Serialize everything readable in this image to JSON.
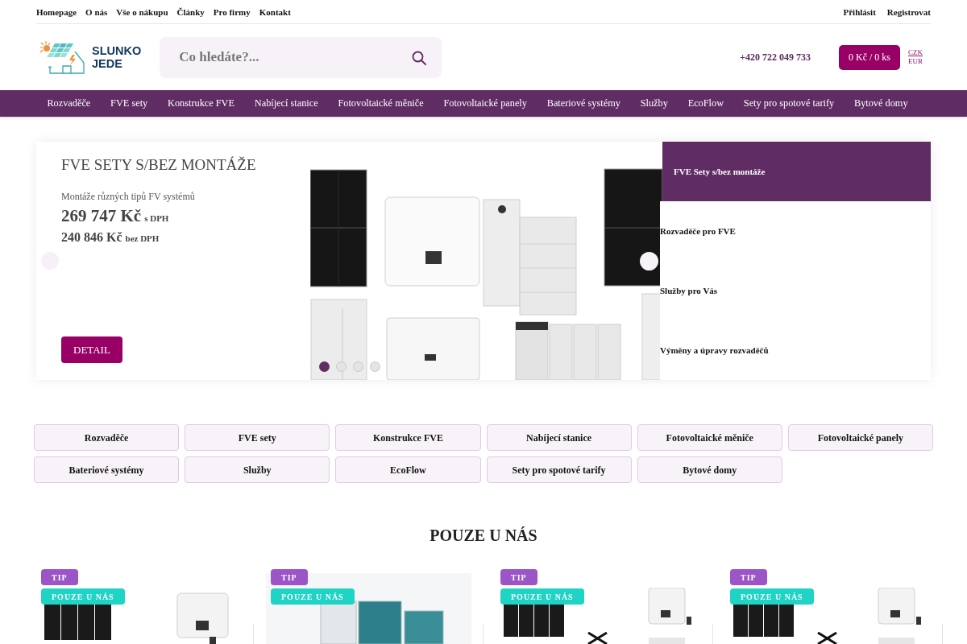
{
  "top_links": [
    "Homepage",
    "O nás",
    "Vše o nákupu",
    "Články",
    "Pro firmy",
    "Kontakt"
  ],
  "account_links": [
    "Přihlásit",
    "Registrovat"
  ],
  "logo": {
    "text_lines": [
      "SLUNKO",
      "JEDE"
    ]
  },
  "search": {
    "placeholder": "Co hledáte?..."
  },
  "phone": "+420 722 049 733",
  "cart": {
    "label": "0 Kč / 0 ks"
  },
  "currencies": [
    {
      "label": "CZK",
      "selected": true
    },
    {
      "label": "EUR",
      "selected": false
    }
  ],
  "nav": [
    "Rozvaděče",
    "FVE sety",
    "Konstrukce FVE",
    "Nabíjecí stanice",
    "Fotovoltaické měniče",
    "Fotovoltaické panely",
    "Bateriové systémy",
    "Služby",
    "EcoFlow",
    "Sety pro spotové tarify",
    "Bytové domy"
  ],
  "hero": {
    "title": "FVE SETY S/BEZ MONTÁŽE",
    "subtitle": "Montáže různých tipů FV systémů",
    "price_with_vat": "269 747 Kč",
    "price_with_vat_note": "s DPH",
    "price_without_vat": "240 846 Kč",
    "price_without_vat_note": "bez DPH",
    "button": "DETAIL",
    "dots": [
      {
        "selected": true
      },
      {
        "selected": false
      },
      {
        "selected": false
      },
      {
        "selected": false
      }
    ],
    "tabs": [
      {
        "label": "FVE Sety s/bez montáže",
        "selected": true
      },
      {
        "label": "Rozvaděče pro FVE",
        "selected": false
      },
      {
        "label": "Služby pro Vás",
        "selected": false
      },
      {
        "label": "Výměny a úpravy rozvaděčů",
        "selected": false
      }
    ]
  },
  "categories": [
    "Rozvaděče",
    "FVE sety",
    "Konstrukce FVE",
    "Nabíjecí stanice",
    "Fotovoltaické měniče",
    "Fotovoltaické panely",
    "Bateriové systémy",
    "Služby",
    "EcoFlow",
    "Sety pro spotové tarify",
    "Bytové domy"
  ],
  "featured": {
    "title": "POUZE U NÁS",
    "products": [
      {
        "kind": "solar_kit",
        "badges": [
          {
            "kind": "tip",
            "label": "TIP"
          },
          {
            "kind": "exclusive",
            "label": "POUZE U NÁS"
          }
        ]
      },
      {
        "kind": "switchboard",
        "badges": [
          {
            "kind": "tip",
            "label": "TIP"
          },
          {
            "kind": "exclusive",
            "label": "POUZE U NÁS"
          }
        ]
      },
      {
        "kind": "install_kit",
        "badges": [
          {
            "kind": "tip",
            "label": "TIP"
          },
          {
            "kind": "exclusive",
            "label": "POUZE U NÁS"
          }
        ]
      },
      {
        "kind": "install_kit",
        "badges": [
          {
            "kind": "tip",
            "label": "TIP"
          },
          {
            "kind": "exclusive",
            "label": "POUZE U NÁS"
          }
        ]
      }
    ]
  }
}
